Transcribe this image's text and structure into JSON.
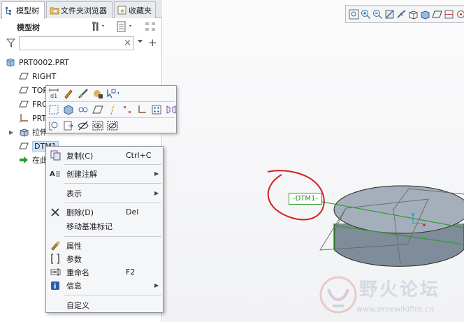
{
  "tabs": [
    {
      "label": "模型树",
      "icon": "model-tree-icon",
      "active": true
    },
    {
      "label": "文件夹浏览器",
      "icon": "folder-icon",
      "active": false
    },
    {
      "label": "收藏夹",
      "icon": "favorites-icon",
      "active": false
    }
  ],
  "tree_header": {
    "title": "模型树"
  },
  "filter": {
    "value": "",
    "placeholder": ""
  },
  "tree": {
    "items": [
      {
        "label": "PRT0002.PRT",
        "icon": "part-icon"
      },
      {
        "label": "RIGHT",
        "icon": "datum-plane-icon"
      },
      {
        "label": "TOP",
        "icon": "datum-plane-icon"
      },
      {
        "label": "FRO",
        "icon": "datum-plane-icon"
      },
      {
        "label": "PRT_",
        "icon": "coordinate-system-icon"
      },
      {
        "label": "拉伸",
        "icon": "extrude-icon"
      },
      {
        "label": "DTM1",
        "icon": "datum-plane-icon"
      },
      {
        "label": "在此",
        "icon": "insert-here-icon"
      }
    ]
  },
  "context_menu": {
    "items": [
      {
        "label": "复制(C)",
        "shortcut": "Ctrl+C",
        "icon": "copy-icon"
      },
      {
        "label": "创建注解",
        "icon": "annotation-icon",
        "submenu": true
      },
      {
        "label": "表示",
        "submenu": true
      },
      {
        "label": "删除(D)",
        "shortcut": "Del",
        "icon": "delete-icon"
      },
      {
        "label": "移动基准标记"
      },
      {
        "label": "属性",
        "icon": "properties-icon"
      },
      {
        "label": "参数",
        "icon": "parameters-icon"
      },
      {
        "label": "重命名",
        "shortcut": "F2",
        "icon": "rename-icon"
      },
      {
        "label": "信息",
        "icon": "info-icon",
        "submenu": true
      },
      {
        "label": "自定义"
      }
    ]
  },
  "graphics": {
    "datum_tag": "-DTM1-"
  },
  "watermark": {
    "text": "野火论坛",
    "url": "www.proewildfire.cn"
  },
  "colors": {
    "datum_green": "#2f9e2f",
    "annotation_red": "#d42020",
    "selection": "#cfe3fb"
  }
}
